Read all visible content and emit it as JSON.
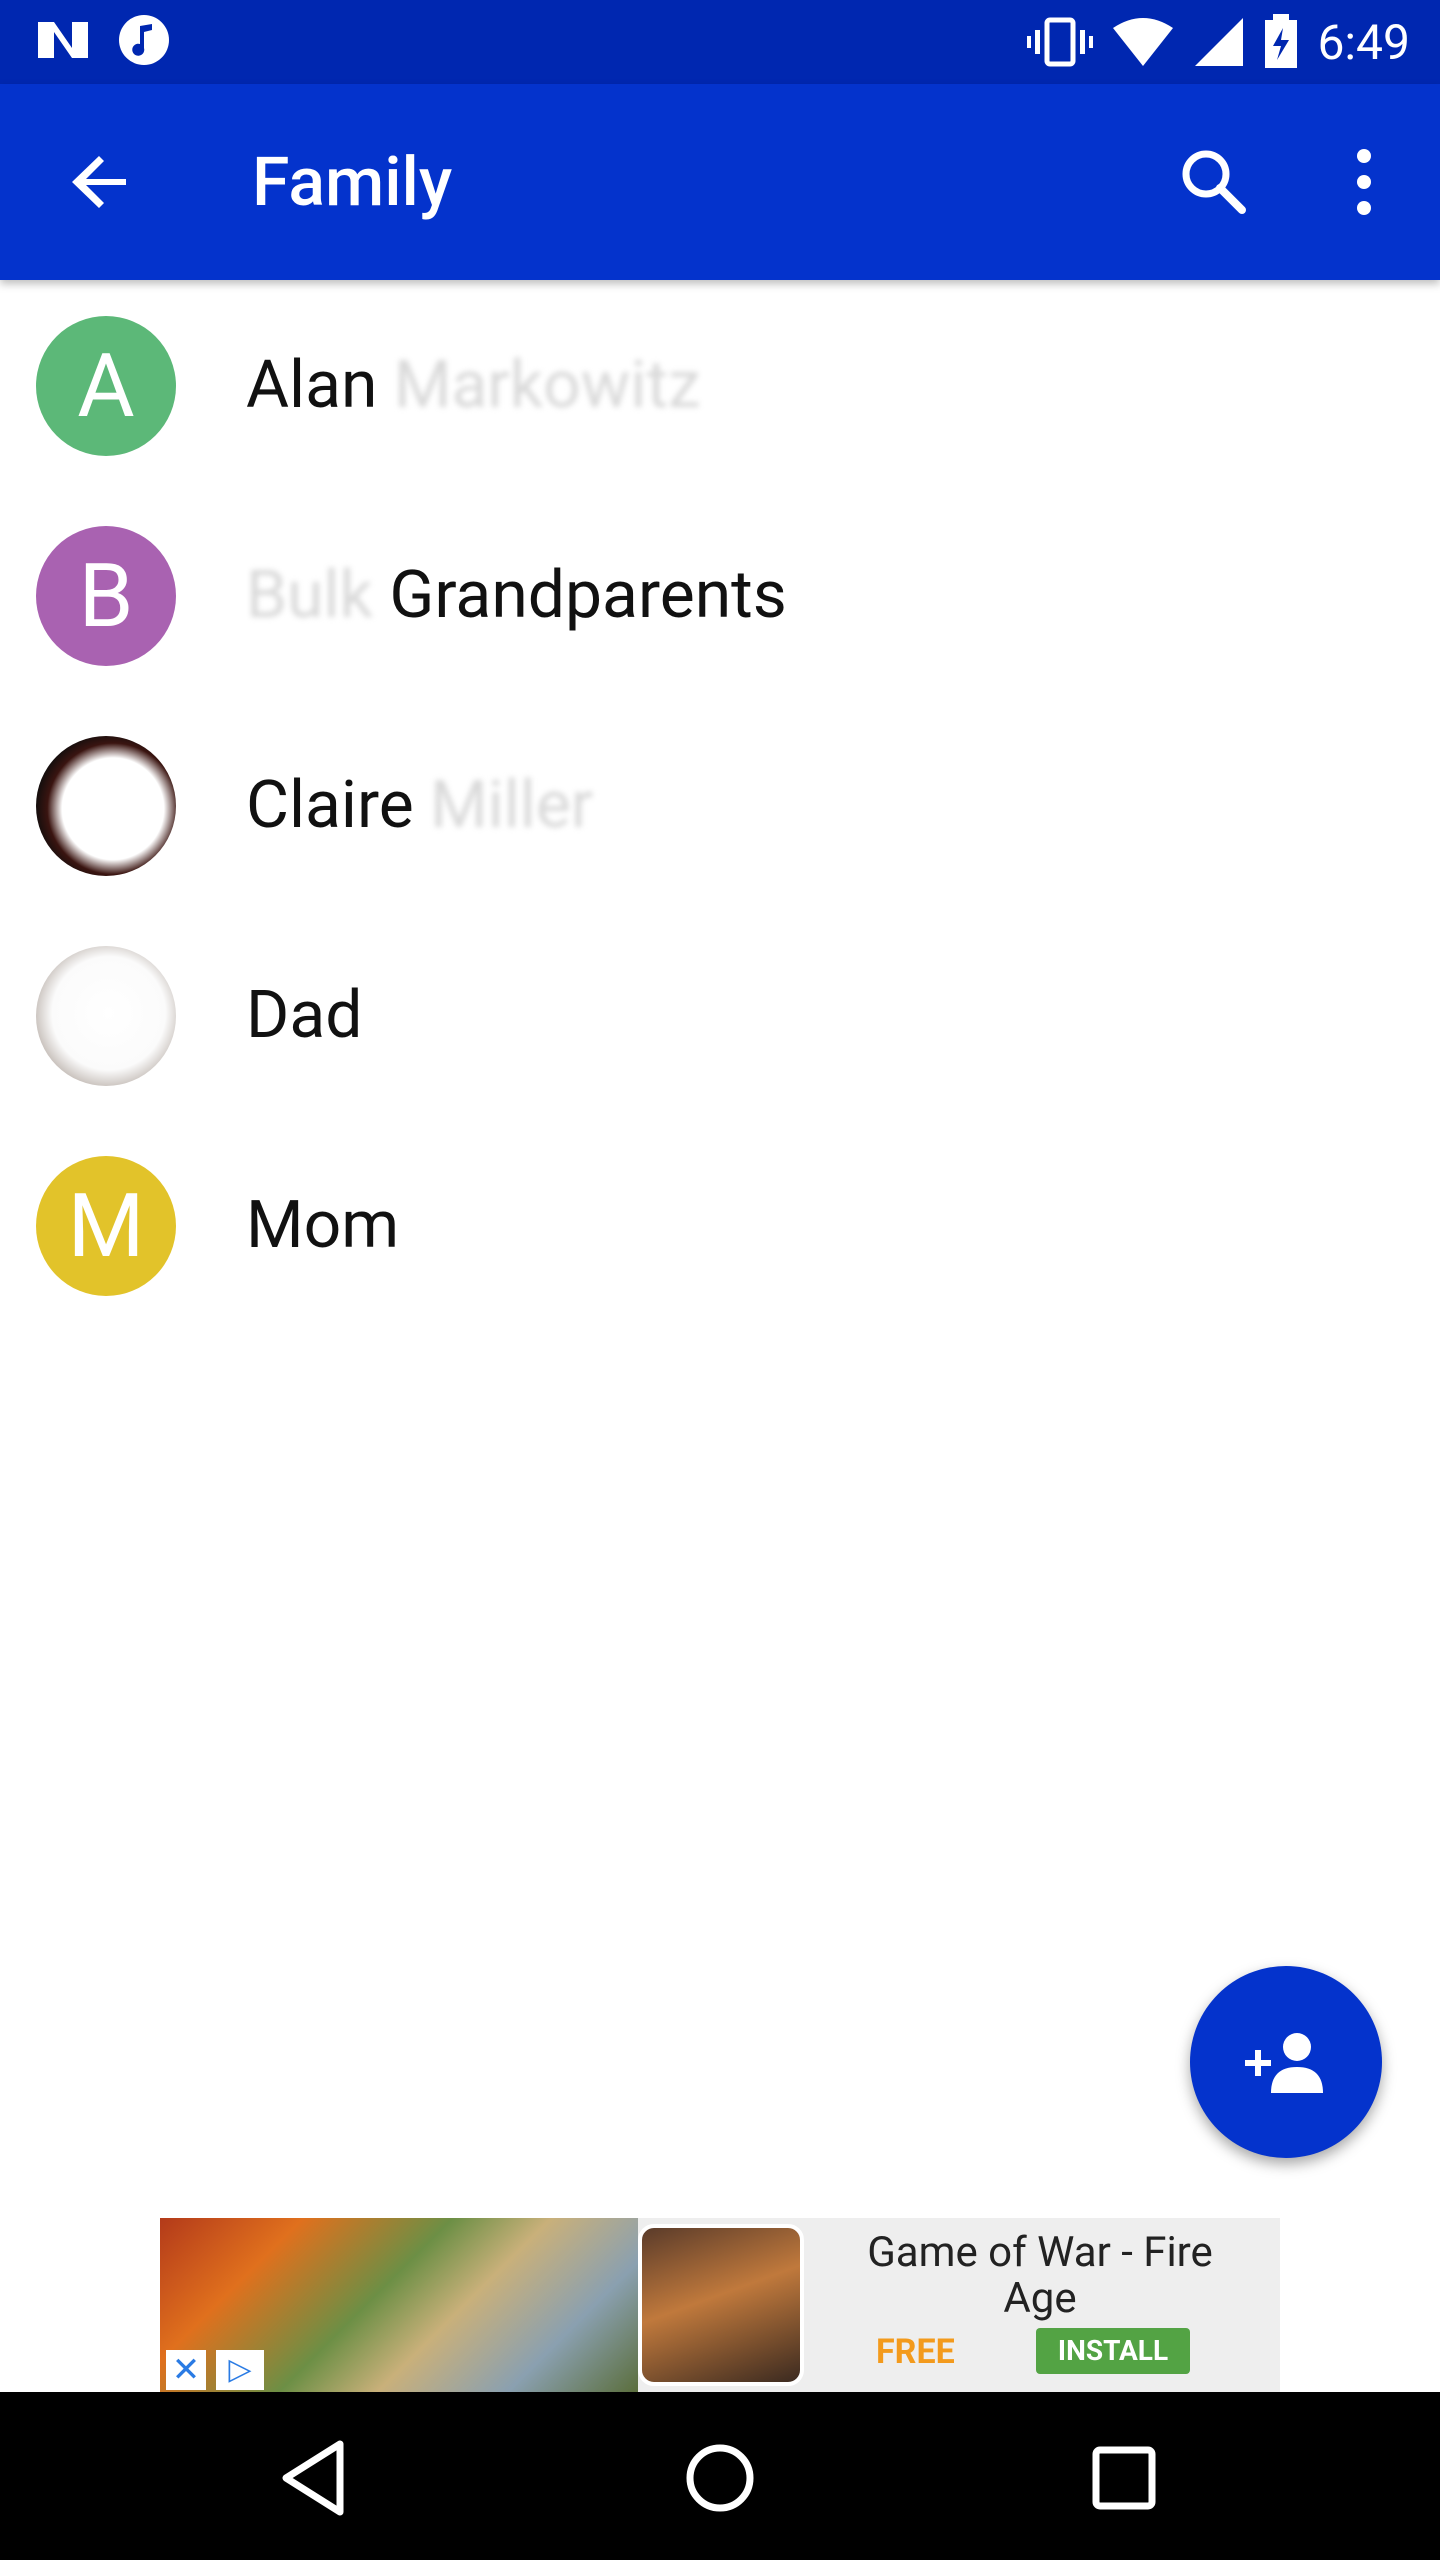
{
  "status_bar": {
    "time": "6:49",
    "icons": [
      "n-icon",
      "music-icon",
      "vibrate-icon",
      "wifi-icon",
      "signal-icon",
      "battery-icon"
    ]
  },
  "app_bar": {
    "title": "Family",
    "icons": [
      "back-arrow-icon",
      "search-icon",
      "more-vert-icon"
    ]
  },
  "contacts": [
    {
      "initial": "A",
      "name_visible": "Alan",
      "name_hidden": " Markowitz",
      "avatar_color": "#5cb878"
    },
    {
      "initial": "B",
      "name_hidden": "Bulk ",
      "name_visible": "Grandparents",
      "avatar_color": "#a962b1"
    },
    {
      "initial": "",
      "name_visible": "Claire",
      "name_hidden": " Miller",
      "avatar_color": "#111111"
    },
    {
      "initial": "",
      "name_visible": "Dad",
      "name_hidden": "",
      "avatar_color": "#cfcfcf"
    },
    {
      "initial": "M",
      "name_visible": "Mom",
      "name_hidden": "",
      "avatar_color": "#e2c32a"
    }
  ],
  "fab": {
    "icon": "add-person-icon",
    "color": "#0433cc"
  },
  "ad": {
    "title": "Game of War - Fire Age",
    "price": "FREE",
    "cta": "INSTALL",
    "close_glyph": "✕",
    "adchoices_glyph": "▷"
  },
  "nav_bar": {
    "icons": [
      "back-triangle-icon",
      "home-circle-icon",
      "recents-square-icon"
    ]
  }
}
